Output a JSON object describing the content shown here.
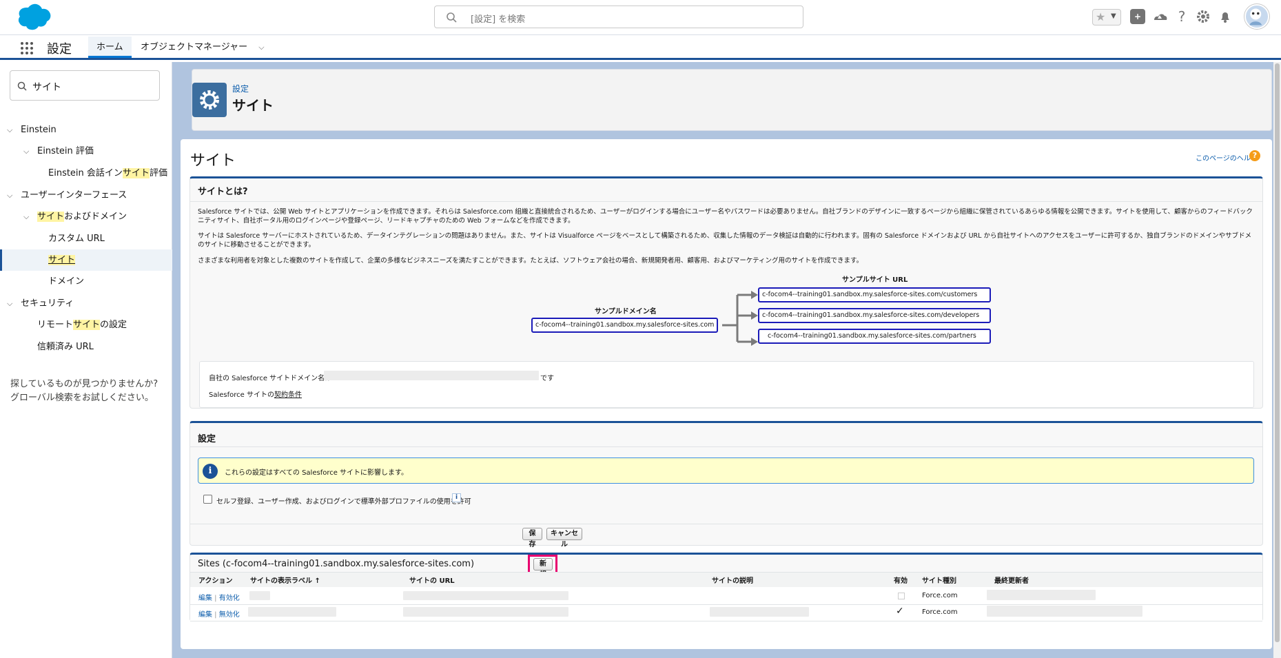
{
  "header": {
    "search_placeholder": "[設定] を検索"
  },
  "nav": {
    "app_name": "設定",
    "tabs": [
      "ホーム",
      "オブジェクトマネージャー"
    ]
  },
  "sidebar": {
    "quick_find": "サイト",
    "items": [
      {
        "pre": "Einstein",
        "hl": "",
        "post": ""
      },
      {
        "pre": "Einstein 評価",
        "hl": "",
        "post": ""
      },
      {
        "pre": "Einstein 会話イン",
        "hl": "サイト",
        "post": "評価"
      },
      {
        "pre": "ユーザーインターフェース",
        "hl": "",
        "post": ""
      },
      {
        "pre": "",
        "hl": "サイト",
        "post": "およびドメイン"
      },
      {
        "pre": "カスタム URL",
        "hl": "",
        "post": ""
      },
      {
        "pre": "",
        "hl": "サイト",
        "post": ""
      },
      {
        "pre": "ドメイン",
        "hl": "",
        "post": ""
      },
      {
        "pre": "セキュリティ",
        "hl": "",
        "post": ""
      },
      {
        "pre": "リモート",
        "hl": "サイト",
        "post": "の設定"
      },
      {
        "pre": "信頼済み URL",
        "hl": "",
        "post": ""
      }
    ],
    "not_found_1": "探しているものが見つかりませんか?",
    "not_found_2": "グローバル検索をお試しください。"
  },
  "page_header": {
    "breadcrumb": "設定",
    "title": "サイト"
  },
  "content": {
    "title": "サイト",
    "help_link": "このページのヘルプ",
    "about": {
      "title": "サイトとは?",
      "p1a": "Salesforce サイトでは、公開 Web サイトとアプリケーションを作成できます。それらは Salesforce.com 組織と直接統合されるため、ユーザーがログインする場合にユーザー名やパスワードは必要ありません。自社ブランドのデザインに一致するページから組織に保管されているあらゆる情報を公開できます。サイトを使用して、顧客からのフィードバック収集のためのコミュ",
      "p1b": "ニティサイト、自社ポータル用のログインページや登録ページ、リードキャプチャのための Web フォームなどを作成できます。",
      "p2a": "サイトは Salesforce サーバーにホストされているため、データインテグレーションの問題はありません。また、サイトは Visualforce ページをベースとして構築されるため、収集した情報のデータ検証は自動的に行われます。固有の Salesforce ドメインおよび URL から自社サイトへのアクセスをユーザーに許可するか、独自ブランドのドメインやサブドメインを登録して自社",
      "p2b": "のサイトに移動させることができます。",
      "p3": "さまざまな利用者を対象とした複数のサイトを作成して、企業の多様なビジネスニーズを満たすことができます。たとえば、ソフトウェア会社の場合、新規開発者用、顧客用、およびマーケティング用のサイトを作成できます。",
      "sample_domain_label": "サンプルドメイン名",
      "sample_domain": "c-focom4--training01.sandbox.my.salesforce-sites.com",
      "sample_url_label": "サンプルサイト URL",
      "sample_urls": [
        "c-focom4--training01.sandbox.my.salesforce-sites.com/customers",
        "c-focom4--training01.sandbox.my.salesforce-sites.com/developers",
        "c-focom4--training01.sandbox.my.salesforce-sites.com/partners"
      ],
      "domain_line_pre": "自社の Salesforce サイトドメイン名は",
      "domain_line_post": "です",
      "terms_pre": "Salesforce サイトの",
      "terms_link": "契約条件"
    },
    "settings": {
      "title": "設定",
      "info": "これらの設定はすべての Salesforce サイトに影響します。",
      "checkbox_label": "セルフ登録、ユーザー作成、およびログインで標準外部プロファイルの使用を許可",
      "save": "保存",
      "cancel": "キャンセル"
    },
    "sites": {
      "title": "Sites (c-focom4--training01.sandbox.my.salesforce-sites.com)",
      "new_button": "新規",
      "columns": [
        "アクション",
        "サイトの表示ラベル ↑",
        "サイトの URL",
        "サイトの説明",
        "有効",
        "サイト種別",
        "最終更新者"
      ],
      "rows": [
        {
          "edit": "編集",
          "toggle": "有効化",
          "active": false,
          "type": "Force.com"
        },
        {
          "edit": "編集",
          "toggle": "無効化",
          "active": true,
          "type": "Force.com"
        }
      ]
    }
  }
}
